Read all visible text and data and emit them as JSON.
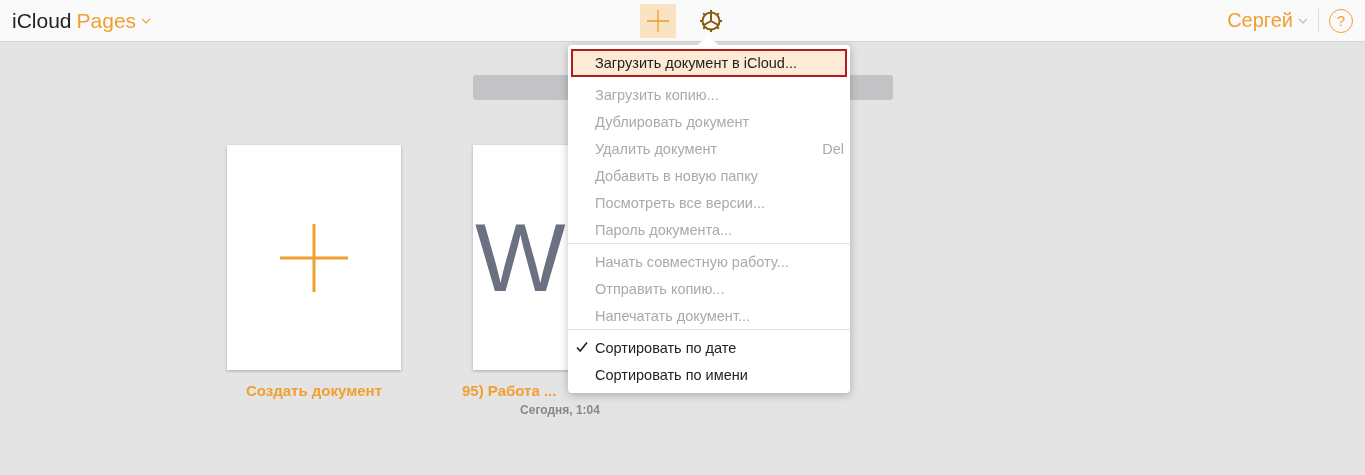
{
  "header": {
    "brand": "iCloud",
    "app": "Pages",
    "user": "Сергей",
    "help": "?"
  },
  "toolbar": {
    "add_selected": true
  },
  "documents": [
    {
      "kind": "create",
      "label": "Создать документ"
    },
    {
      "kind": "file",
      "thumbnail_letter": "W",
      "label": "95) Работа ...",
      "date": "Сегодня, 1:04"
    }
  ],
  "menu": {
    "groups": [
      [
        {
          "label": "Загрузить документ в iCloud...",
          "enabled": true,
          "highlighted": true
        }
      ],
      [
        {
          "label": "Загрузить копию...",
          "enabled": false
        },
        {
          "label": "Дублировать документ",
          "enabled": false
        },
        {
          "label": "Удалить документ",
          "shortcut": "Del",
          "enabled": false
        },
        {
          "label": "Добавить в новую папку",
          "enabled": false
        },
        {
          "label": "Посмотреть все версии...",
          "enabled": false
        },
        {
          "label": "Пароль документа...",
          "enabled": false
        }
      ],
      [
        {
          "label": "Начать совместную работу...",
          "enabled": false
        },
        {
          "label": "Отправить копию...",
          "enabled": false
        },
        {
          "label": "Напечатать документ...",
          "enabled": false
        }
      ],
      [
        {
          "label": "Сортировать по дате",
          "enabled": true,
          "checked": true
        },
        {
          "label": "Сортировать по имени",
          "enabled": true,
          "checked": false
        }
      ]
    ]
  }
}
